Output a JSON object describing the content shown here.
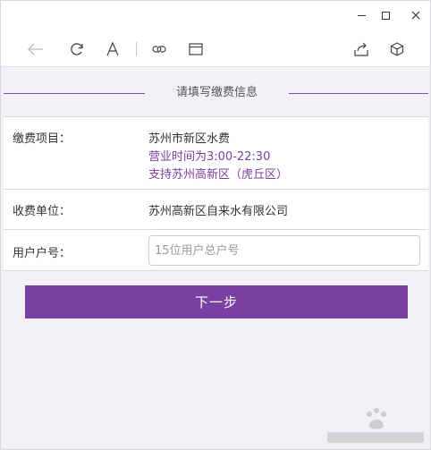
{
  "form": {
    "title": "请填写缴费信息",
    "item_label": "缴费项目：",
    "item_value": "苏州市新区水费",
    "item_hours": "营业时间为3:00-22:30",
    "item_support": "支持苏州高新区（虎丘区）",
    "unit_label": "收费单位：",
    "unit_value": "苏州高新区自来水有限公司",
    "account_label": "用户户号：",
    "account_value": "",
    "account_placeholder": "15位用户总户号",
    "next_label": "下一步"
  },
  "colors": {
    "accent": "#7a3fa3",
    "background": "#f3f1f6"
  },
  "toolbar": {
    "icons": [
      "back-arrow-icon",
      "refresh-icon",
      "font-size-icon",
      "link-icon",
      "window-icon",
      "share-icon",
      "cube-icon"
    ]
  }
}
